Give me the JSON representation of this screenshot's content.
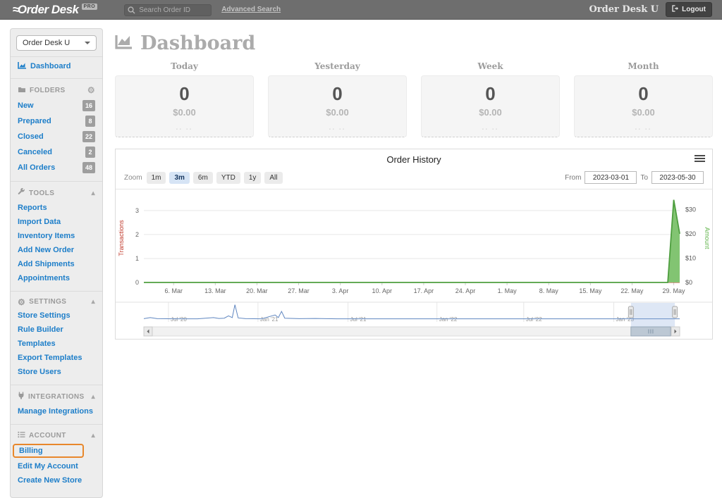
{
  "navbar": {
    "logo": "Order Desk",
    "logo_badge": "PRO",
    "search_placeholder": "Search Order ID",
    "advanced_search": "Advanced Search",
    "user": "Order Desk U",
    "logout": "Logout"
  },
  "sidebar": {
    "store_select": "Order Desk U",
    "dashboard": "Dashboard",
    "sections": [
      {
        "label": "FOLDERS",
        "items": [
          {
            "label": "New",
            "badge": "16"
          },
          {
            "label": "Prepared",
            "badge": "8"
          },
          {
            "label": "Closed",
            "badge": "22"
          },
          {
            "label": "Canceled",
            "badge": "2"
          },
          {
            "label": "All Orders",
            "badge": "48"
          }
        ]
      },
      {
        "label": "TOOLS",
        "items": [
          {
            "label": "Reports"
          },
          {
            "label": "Import Data"
          },
          {
            "label": "Inventory Items"
          },
          {
            "label": "Add New Order"
          },
          {
            "label": "Add Shipments"
          },
          {
            "label": "Appointments"
          }
        ]
      },
      {
        "label": "SETTINGS",
        "items": [
          {
            "label": "Store Settings"
          },
          {
            "label": "Rule Builder"
          },
          {
            "label": "Templates"
          },
          {
            "label": "Export Templates"
          },
          {
            "label": "Store Users"
          }
        ]
      },
      {
        "label": "INTEGRATIONS",
        "items": [
          {
            "label": "Manage Integrations"
          }
        ]
      },
      {
        "label": "ACCOUNT",
        "items": [
          {
            "label": "Billing",
            "highlighted": true
          },
          {
            "label": "Edit My Account"
          },
          {
            "label": "Create New Store"
          }
        ]
      }
    ]
  },
  "main": {
    "page_title": "Dashboard",
    "stats": [
      {
        "label": "Today",
        "count": "0",
        "amount": "$0.00",
        "sub": ".. .."
      },
      {
        "label": "Yesterday",
        "count": "0",
        "amount": "$0.00",
        "sub": ".. .."
      },
      {
        "label": "Week",
        "count": "0",
        "amount": "$0.00",
        "sub": ".. .."
      },
      {
        "label": "Month",
        "count": "0",
        "amount": "$0.00",
        "sub": ".. .."
      }
    ],
    "panel": {
      "title": "Order History",
      "zoom_label": "Zoom",
      "zoom_buttons": [
        "1m",
        "3m",
        "6m",
        "YTD",
        "1y",
        "All"
      ],
      "zoom_active": "3m",
      "from_label": "From",
      "from_value": "2023-03-01",
      "to_label": "To",
      "to_value": "2023-05-30"
    }
  },
  "icons": {
    "gear": "⚙",
    "collapse": "▴"
  },
  "colors": {
    "accent_blue": "#1d7ec9",
    "highlight_orange": "#e8872b",
    "chart_green": "#5aa84b",
    "chart_red": "#c0392b",
    "navigator_blue": "#5f86c0"
  },
  "chart_data": [
    {
      "type": "area",
      "title": "Order History",
      "x_axis": {
        "from": "2023-03-01",
        "to": "2023-05-30",
        "range_days": [
          0,
          90
        ],
        "tick_days": [
          5,
          12,
          19,
          26,
          33,
          40,
          47,
          54,
          61,
          68,
          75,
          82,
          89
        ],
        "tick_labels": [
          "6. Mar",
          "13. Mar",
          "20. Mar",
          "27. Mar",
          "3. Apr",
          "10. Apr",
          "17. Apr",
          "24. Apr",
          "1. May",
          "8. May",
          "15. May",
          "22. May",
          "29. May"
        ]
      },
      "y_left": {
        "label": "Transactions",
        "color": "#c0392b",
        "tick_values": [
          0,
          1,
          2,
          3
        ],
        "plot_max": 3.7
      },
      "y_right": {
        "label": "Amount",
        "color": "#63b54d",
        "tick_values": [
          0,
          10,
          20,
          30
        ],
        "tick_labels": [
          "$0",
          "$10",
          "$20",
          "$30"
        ],
        "plot_max": 36.5
      },
      "series": [
        {
          "name": "Transactions",
          "axis": "left",
          "color": "#c0392b",
          "points": [
            [
              0,
              0
            ],
            [
              90,
              0
            ]
          ]
        },
        {
          "name": "Amount",
          "axis": "right",
          "color": "#4e9e3f",
          "fill": "#82c472",
          "points": [
            [
              0,
              0
            ],
            [
              88,
              0
            ],
            [
              89,
              34
            ],
            [
              90,
              20
            ]
          ]
        }
      ],
      "grid": true,
      "legend": "none"
    },
    {
      "type": "navigator",
      "line_color": "#5f86c0",
      "x_labels": [
        "Jul '20",
        "Jan '21",
        "Jul '21",
        "Jan '22",
        "Jul '22",
        "Jan '23"
      ],
      "x_label_fracs": [
        0.046,
        0.213,
        0.381,
        0.547,
        0.709,
        0.877
      ],
      "points": [
        [
          0.0,
          0.03
        ],
        [
          0.012,
          0.1
        ],
        [
          0.025,
          0.03
        ],
        [
          0.06,
          0.02
        ],
        [
          0.1,
          0.02
        ],
        [
          0.13,
          0.1
        ],
        [
          0.14,
          0.04
        ],
        [
          0.15,
          0.06
        ],
        [
          0.158,
          0.22
        ],
        [
          0.165,
          0.1
        ],
        [
          0.17,
          0.97
        ],
        [
          0.176,
          0.08
        ],
        [
          0.19,
          0.03
        ],
        [
          0.22,
          0.02
        ],
        [
          0.245,
          0.28
        ],
        [
          0.251,
          0.1
        ],
        [
          0.257,
          0.52
        ],
        [
          0.263,
          0.06
        ],
        [
          0.29,
          0.03
        ],
        [
          0.32,
          0.04
        ],
        [
          0.36,
          0.02
        ],
        [
          0.45,
          0.02
        ],
        [
          0.6,
          0.02
        ],
        [
          0.75,
          0.015
        ],
        [
          0.88,
          0.015
        ],
        [
          1.0,
          0.015
        ]
      ],
      "selection_frac": [
        0.909,
        0.991
      ]
    }
  ]
}
